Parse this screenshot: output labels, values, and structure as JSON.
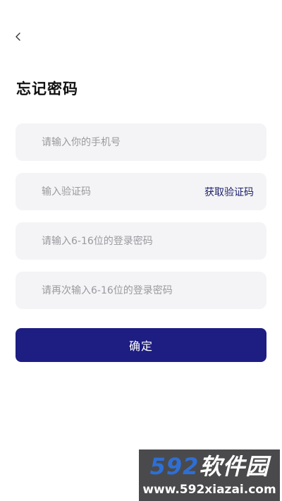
{
  "header": {
    "back_icon": "chevron-left-icon",
    "title": "忘记密码"
  },
  "form": {
    "phone_placeholder": "请输入你的手机号",
    "code_placeholder": "输入验证码",
    "get_code_label": "获取验证码",
    "password_placeholder": "请输入6-16位的登录密码",
    "confirm_password_placeholder": "请再次输入6-16位的登录密码",
    "confirm_label": "确定"
  },
  "watermark": {
    "brand_number": "592",
    "brand_text": "软件园",
    "url": "www.592xiazai.com"
  },
  "colors": {
    "accent": "#1d1d82",
    "input_background": "#f4f4f6",
    "placeholder": "#9a9a9f",
    "link": "#1b1f6a"
  }
}
